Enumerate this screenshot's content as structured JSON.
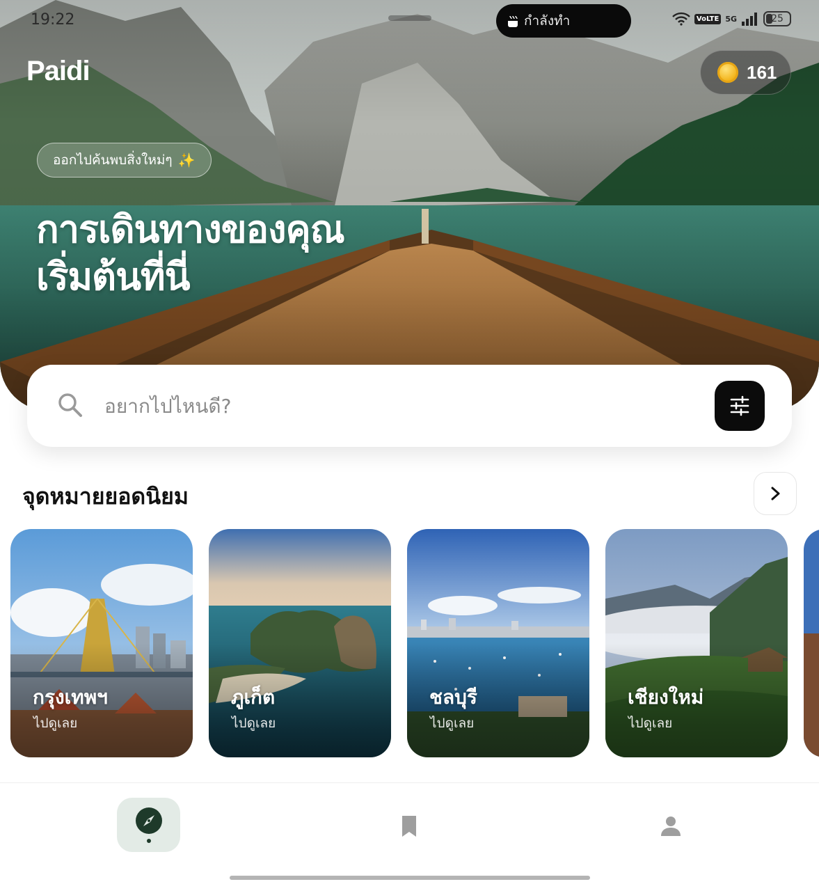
{
  "status_bar": {
    "time": "19:22",
    "activity": "กำลังทำ",
    "network": "5G",
    "volte": "VoLTE",
    "battery": "25"
  },
  "header": {
    "brand": "Paidi",
    "coins": "161"
  },
  "hero": {
    "chip_text": "ออกไปค้นพบสิ่งใหม่ๆ",
    "chip_emoji": "✨",
    "title_line1": "การเดินทางของคุณ",
    "title_line2": "เริ่มต้นที่นี่"
  },
  "search": {
    "placeholder": "อยากไปไหนดี?"
  },
  "popular": {
    "title": "จุดหมายยอดนิยม",
    "cards": [
      {
        "name": "กรุงเทพฯ",
        "cta": "ไปดูเลย"
      },
      {
        "name": "ภูเก็ต",
        "cta": "ไปดูเลย"
      },
      {
        "name": "ชลบุรี",
        "cta": "ไปดูเลย"
      },
      {
        "name": "เชียงใหม่",
        "cta": "ไปดูเลย"
      }
    ]
  },
  "nav": {
    "items": [
      "compass-icon",
      "bookmark-icon",
      "person-icon"
    ],
    "active": "compass-icon"
  },
  "colors": {
    "accent_dark": "#1e3a2a",
    "nav_active_bg": "#e3ebe6",
    "filter_bg": "#0b0b0b"
  }
}
